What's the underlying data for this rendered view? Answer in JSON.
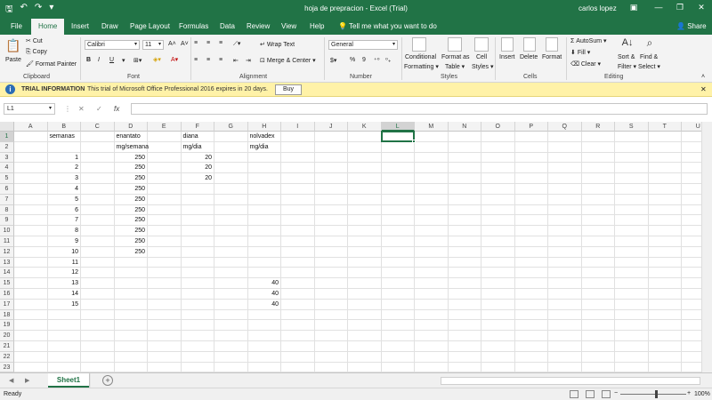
{
  "window": {
    "title": "hoja de prepracion  -  Excel (Trial)",
    "user": "carlos lopez",
    "share": "Share"
  },
  "tabs": [
    "File",
    "Home",
    "Insert",
    "Draw",
    "Page Layout",
    "Formulas",
    "Data",
    "Review",
    "View",
    "Help"
  ],
  "tell_me": "Tell me what you want to do",
  "ribbon": {
    "clipboard": {
      "paste": "Paste",
      "cut": "Cut",
      "copy": "Copy",
      "format_painter": "Format Painter",
      "label": "Clipboard"
    },
    "font": {
      "name": "Calibri",
      "size": "11",
      "bold": "B",
      "italic": "I",
      "underline": "U",
      "label": "Font"
    },
    "alignment": {
      "wrap": "Wrap Text",
      "merge": "Merge & Center",
      "label": "Alignment"
    },
    "number": {
      "format": "General",
      "currency": "$",
      "percent": "%",
      "comma": "9",
      "label": "Number"
    },
    "styles": {
      "conditional": "Conditional",
      "conditional2": "Formatting",
      "format_as": "Format as",
      "format_as2": "Table",
      "cell": "Cell",
      "cell2": "Styles",
      "label": "Styles"
    },
    "cells": {
      "insert": "Insert",
      "delete": "Delete",
      "format": "Format",
      "label": "Cells"
    },
    "editing": {
      "autosum": "AutoSum",
      "fill": "Fill",
      "clear": "Clear",
      "sort": "Sort &",
      "sort2": "Filter",
      "find": "Find &",
      "find2": "Select",
      "label": "Editing"
    }
  },
  "infobar": {
    "title": "TRIAL INFORMATION",
    "message": "This trial of Microsoft Office Professional 2016 expires in 20 days.",
    "button": "Buy"
  },
  "formula_bar": {
    "name_box": "L1",
    "fx": "fx",
    "value": ""
  },
  "grid": {
    "columns": [
      "A",
      "B",
      "C",
      "D",
      "E",
      "F",
      "G",
      "H",
      "I",
      "J",
      "K",
      "L",
      "M",
      "N",
      "O",
      "P",
      "Q",
      "R",
      "S",
      "T",
      "U"
    ],
    "rows": [
      "1",
      "2",
      "3",
      "4",
      "5",
      "6",
      "7",
      "8",
      "9",
      "10",
      "11",
      "12",
      "13",
      "14",
      "15",
      "16",
      "17",
      "18",
      "19",
      "20",
      "21",
      "22",
      "23"
    ],
    "selected_column": "L",
    "selected_row": "1",
    "cells": [
      {
        "ref": "B1",
        "value": "semanas",
        "align": "left"
      },
      {
        "ref": "D1",
        "value": "enantato",
        "align": "left"
      },
      {
        "ref": "F1",
        "value": "diana",
        "align": "left"
      },
      {
        "ref": "H1",
        "value": "nolvadex",
        "align": "left"
      },
      {
        "ref": "D2",
        "value": "mg/semana",
        "align": "left"
      },
      {
        "ref": "F2",
        "value": "mg/dia",
        "align": "left"
      },
      {
        "ref": "H2",
        "value": "mg/dia",
        "align": "left"
      },
      {
        "ref": "B3",
        "value": "1",
        "align": "right"
      },
      {
        "ref": "D3",
        "value": "250",
        "align": "right"
      },
      {
        "ref": "F3",
        "value": "20",
        "align": "right"
      },
      {
        "ref": "B4",
        "value": "2",
        "align": "right"
      },
      {
        "ref": "D4",
        "value": "250",
        "align": "right"
      },
      {
        "ref": "F4",
        "value": "20",
        "align": "right"
      },
      {
        "ref": "B5",
        "value": "3",
        "align": "right"
      },
      {
        "ref": "D5",
        "value": "250",
        "align": "right"
      },
      {
        "ref": "F5",
        "value": "20",
        "align": "right"
      },
      {
        "ref": "B6",
        "value": "4",
        "align": "right"
      },
      {
        "ref": "D6",
        "value": "250",
        "align": "right"
      },
      {
        "ref": "B7",
        "value": "5",
        "align": "right"
      },
      {
        "ref": "D7",
        "value": "250",
        "align": "right"
      },
      {
        "ref": "B8",
        "value": "6",
        "align": "right"
      },
      {
        "ref": "D8",
        "value": "250",
        "align": "right"
      },
      {
        "ref": "B9",
        "value": "7",
        "align": "right"
      },
      {
        "ref": "D9",
        "value": "250",
        "align": "right"
      },
      {
        "ref": "B10",
        "value": "8",
        "align": "right"
      },
      {
        "ref": "D10",
        "value": "250",
        "align": "right"
      },
      {
        "ref": "B11",
        "value": "9",
        "align": "right"
      },
      {
        "ref": "D11",
        "value": "250",
        "align": "right"
      },
      {
        "ref": "B12",
        "value": "10",
        "align": "right"
      },
      {
        "ref": "D12",
        "value": "250",
        "align": "right"
      },
      {
        "ref": "B13",
        "value": "11",
        "align": "right"
      },
      {
        "ref": "B14",
        "value": "12",
        "align": "right"
      },
      {
        "ref": "B15",
        "value": "13",
        "align": "right"
      },
      {
        "ref": "H15",
        "value": "40",
        "align": "right"
      },
      {
        "ref": "B16",
        "value": "14",
        "align": "right"
      },
      {
        "ref": "H16",
        "value": "40",
        "align": "right"
      },
      {
        "ref": "B17",
        "value": "15",
        "align": "right"
      },
      {
        "ref": "H17",
        "value": "40",
        "align": "right"
      }
    ]
  },
  "sheets": [
    "Sheet1"
  ],
  "status": {
    "ready": "Ready",
    "zoom": "100%"
  },
  "colors": {
    "accent": "#217346",
    "infobar": "#fff2a8"
  }
}
